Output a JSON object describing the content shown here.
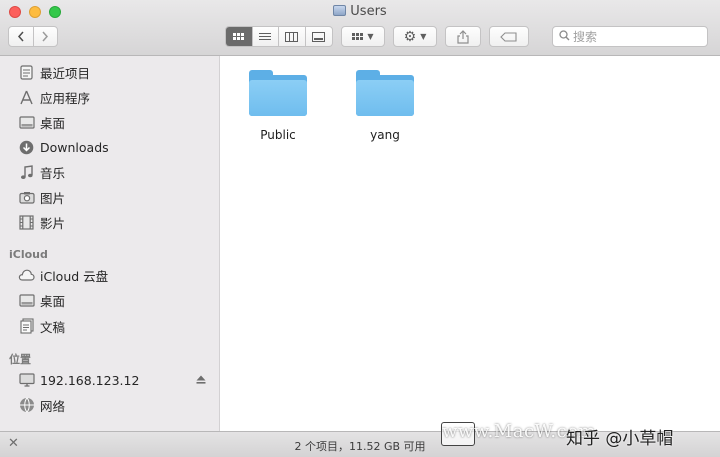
{
  "window": {
    "title": "Users"
  },
  "toolbar": {
    "back_label": "<",
    "forward_label": ">",
    "search_placeholder": "搜索"
  },
  "sidebar": {
    "favorites": [
      {
        "label": "最近项目",
        "icon": "recents-icon"
      },
      {
        "label": "应用程序",
        "icon": "applications-icon"
      },
      {
        "label": "桌面",
        "icon": "desktop-icon"
      },
      {
        "label": "Downloads",
        "icon": "downloads-icon"
      },
      {
        "label": "音乐",
        "icon": "music-icon"
      },
      {
        "label": "图片",
        "icon": "pictures-icon"
      },
      {
        "label": "影片",
        "icon": "movies-icon"
      }
    ],
    "icloud_header": "iCloud",
    "icloud": [
      {
        "label": "iCloud 云盘",
        "icon": "icloud-drive-icon"
      },
      {
        "label": "桌面",
        "icon": "desktop-icon"
      },
      {
        "label": "文稿",
        "icon": "documents-icon"
      }
    ],
    "locations_header": "位置",
    "locations": [
      {
        "label": "192.168.123.12",
        "icon": "computer-icon"
      },
      {
        "label": "网络",
        "icon": "network-icon"
      }
    ]
  },
  "content": {
    "folders": [
      {
        "name": "Public"
      },
      {
        "name": "yang"
      }
    ]
  },
  "statusbar": {
    "text": "2 个项目，11.52 GB 可用"
  },
  "watermark": {
    "text": "知乎 @小草帽",
    "overlay": "www.MacW.com"
  },
  "colors": {
    "folder": "#6fbdee",
    "sidebar_bg": "#eceaec",
    "titlebar_bg": "#dfdedf"
  }
}
